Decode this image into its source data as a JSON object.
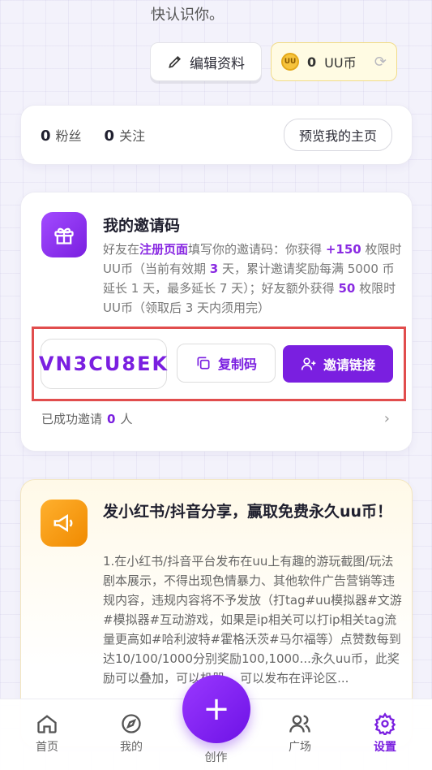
{
  "header": {
    "intro_tail": "快认识你。"
  },
  "profile_actions": {
    "edit_label": "编辑资料",
    "coin_count": "0",
    "coin_unit": "UU币",
    "coin_icon_text": "UU"
  },
  "stats": {
    "fans_count": "0",
    "fans_label": "粉丝",
    "following_count": "0",
    "following_label": "关注",
    "preview_label": "预览我的主页"
  },
  "invite": {
    "title": "我的邀请码",
    "desc_part1": "好友在",
    "desc_link": "注册页面",
    "desc_part2": "填写你的邀请码：你获得 ",
    "desc_bonus1": "+150",
    "desc_part3": " 枚限时 UU币（当前有效期 ",
    "desc_days": "3",
    "desc_part4": " 天，累计邀请奖励每满 5000 币延长 1 天，最多延长 7 天）；好友额外获得 ",
    "desc_bonus2": "50",
    "desc_part5": " 枚限时 UU币（领取后 3 天内须用完）",
    "code": "VN3CU8EK",
    "copy_label": "复制码",
    "link_label": "邀请链接",
    "invited_prefix": "已成功邀请",
    "invited_count": "0",
    "invited_suffix": "人"
  },
  "share": {
    "title": "发小红书/抖音分享，赢取免费永久uu币！",
    "body": "1.在小红书/抖音平台发布在uu上有趣的游玩截图/玩法剧本展示，不得出现色情暴力、其他软件广告营销等违规内容，违规内容将不予发放（打tag#uu模拟器#文游#模拟器#互动游戏，如果是ip相关可以打ip相关tag流量更高如#哈利波特#霍格沃茨#马尔福等）点赞数每到达10/100/1000分别奖励100,1000...永久uu币，此奖励可以叠加，可以机器... 可以发布在评论区..."
  },
  "nav": {
    "home": "首页",
    "mine": "我的",
    "create": "创作",
    "square": "广场",
    "settings": "设置"
  },
  "colors": {
    "accent": "#7a1fe0",
    "highlight_frame": "#e14d4d",
    "coin_gold": "#f6c33c"
  }
}
